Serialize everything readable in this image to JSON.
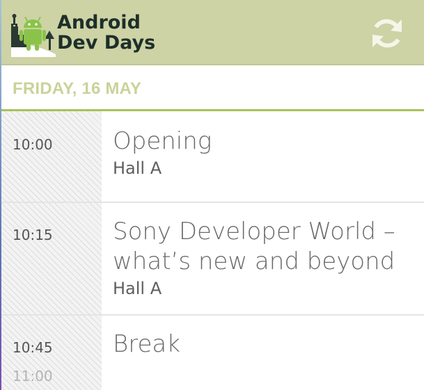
{
  "action_bar": {
    "logo": {
      "line1": "Android",
      "line2": "Dev Days",
      "icon": "android-robot-with-castle-icon"
    },
    "refresh_icon": "refresh-icon",
    "colors": {
      "background": "#cdd3a5",
      "logo_text": "#1e2f2a",
      "refresh_icon": "#f4f6e8"
    }
  },
  "day_header": {
    "label": "FRIDAY, 16 MAY",
    "colors": {
      "text": "#c9d39a",
      "underline": "#a8c25a"
    }
  },
  "sessions": [
    {
      "start": "10:00",
      "end": "",
      "title": "Opening",
      "room": "Hall A"
    },
    {
      "start": "10:15",
      "end": "",
      "title": "Sony Developer World – what’s new and beyond",
      "room": "Hall A"
    },
    {
      "start": "10:45",
      "end": "11:00",
      "title": "Break",
      "room": ""
    }
  ]
}
